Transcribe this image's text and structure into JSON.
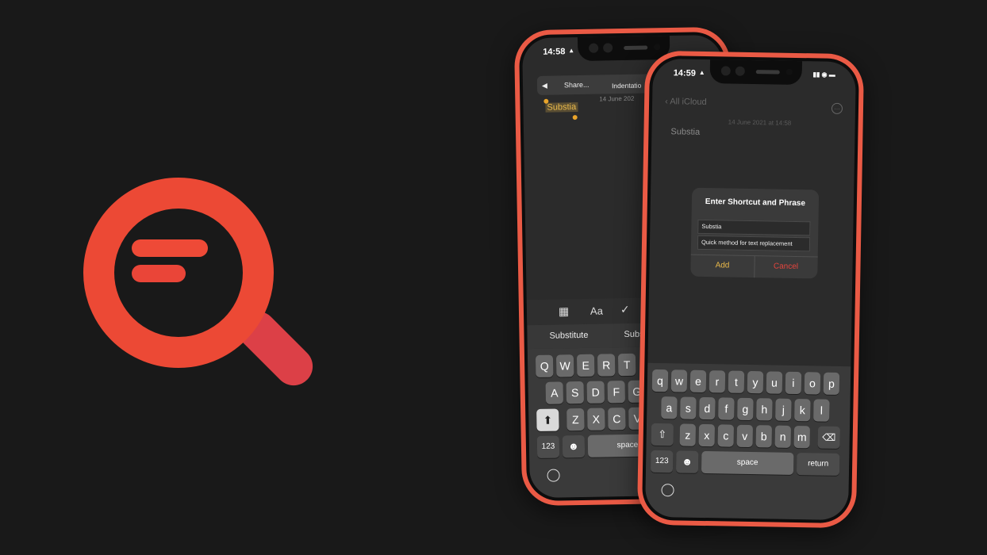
{
  "colors": {
    "accent": "#EC4935",
    "background": "#191919",
    "phone_frame": "#EA5A45",
    "highlight": "#E9B94A",
    "cancel": "#E5443D"
  },
  "logo": {
    "icon": "search-list-icon"
  },
  "back_phone": {
    "time": "14:58",
    "menu": {
      "back": "◀",
      "share": "Share...",
      "indentation": "Indentatio"
    },
    "date": "14 June 202",
    "selected_text": "Substia",
    "toolbar": {
      "table_icon": "table-icon",
      "format": "Aa",
      "check_icon": "checklist-icon"
    },
    "suggestions": [
      "Substitute",
      "Subs"
    ],
    "keys_row1": [
      "Q",
      "W",
      "E",
      "R",
      "T"
    ],
    "keys_row2": [
      "A",
      "S",
      "D",
      "F",
      "G"
    ],
    "keys_row3": [
      "Z",
      "X",
      "C",
      "V"
    ],
    "numbers_key": "123",
    "emoji_key": "☻",
    "space_key": "space",
    "globe_key": "globe-icon",
    "shift_key": "shift-icon"
  },
  "front_phone": {
    "time": "14:59",
    "back_label": "All iCloud",
    "date": "14 June 2021 at 14:58",
    "note_text": "Substia",
    "dialog": {
      "title": "Enter Shortcut and Phrase",
      "shortcut_value": "Substia",
      "phrase_value": "Quick method for text replacement",
      "add_label": "Add",
      "cancel_label": "Cancel"
    },
    "keys_row1": [
      "q",
      "w",
      "e",
      "r",
      "t",
      "y",
      "u",
      "i",
      "o",
      "p"
    ],
    "keys_row2": [
      "a",
      "s",
      "d",
      "f",
      "g",
      "h",
      "j",
      "k",
      "l"
    ],
    "keys_row3": [
      "z",
      "x",
      "c",
      "v",
      "b",
      "n",
      "m"
    ],
    "numbers_key": "123",
    "emoji_key": "☻",
    "space_key": "space",
    "return_key": "return",
    "globe_key": "globe-icon",
    "shift_key": "shift-icon",
    "delete_key": "delete-icon"
  }
}
